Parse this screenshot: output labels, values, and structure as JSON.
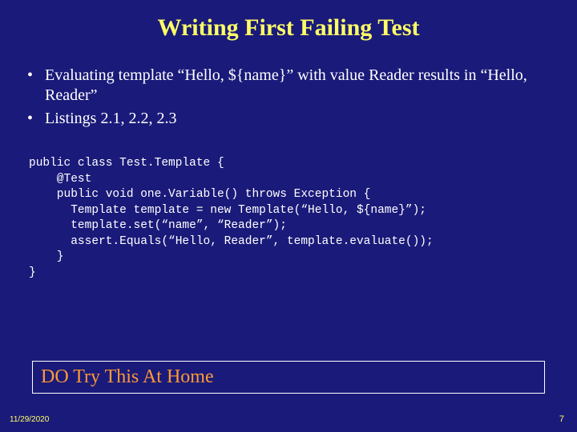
{
  "title": "Writing First Failing Test",
  "bullets": [
    "Evaluating template “Hello, ${name}” with value Reader results in “Hello, Reader”",
    "Listings 2.1, 2.2, 2.3"
  ],
  "code": "public class Test.Template {\n    @Test\n    public void one.Variable() throws Exception {\n      Template template = new Template(“Hello, ${name}”);\n      template.set(“name”, “Reader”);\n      assert.Equals(“Hello, Reader”, template.evaluate());\n    }\n}",
  "callout": "DO Try This At Home",
  "footer_date": "11/29/2020",
  "page_number": "7"
}
